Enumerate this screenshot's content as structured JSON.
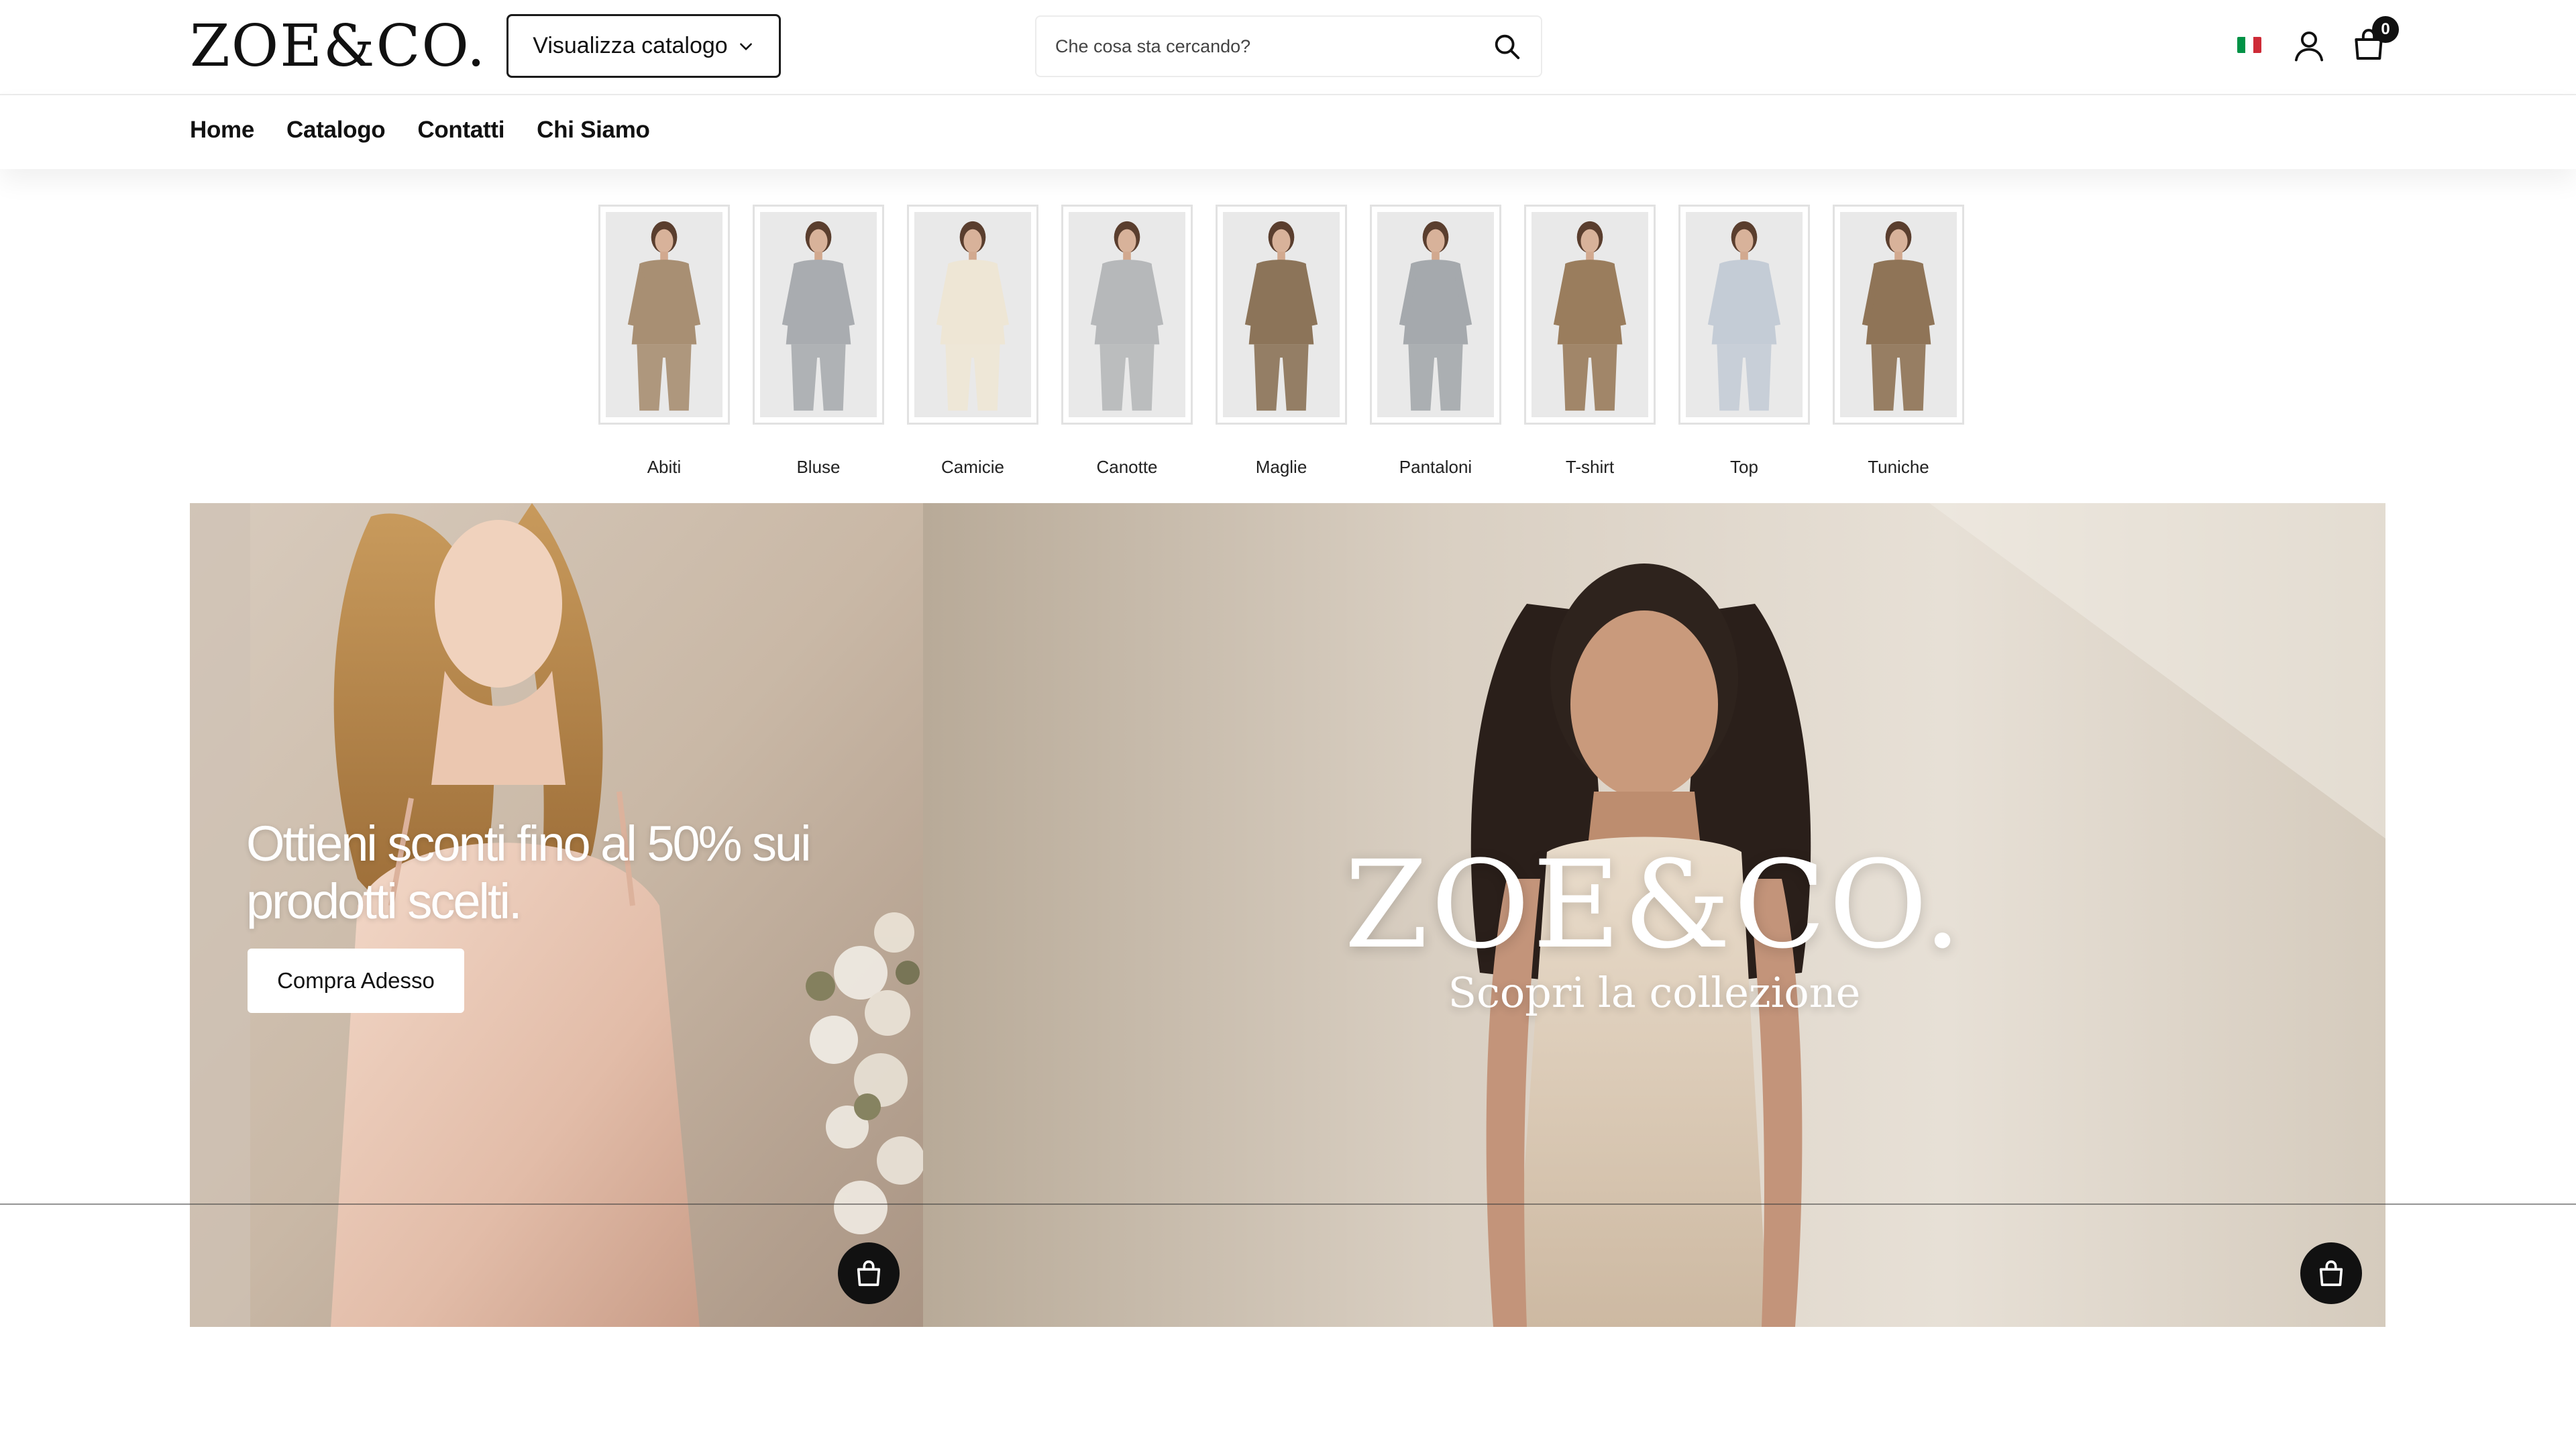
{
  "header": {
    "logo": "ZOE&CO.",
    "catalog_button": "Visualizza catalogo",
    "search_placeholder": "Che cosa sta cercando?",
    "cart_count": "0",
    "flag_colors": [
      "#009246",
      "#ffffff",
      "#ce2b37"
    ]
  },
  "nav": {
    "items": [
      "Home",
      "Catalogo",
      "Contatti",
      "Chi Siamo"
    ]
  },
  "categories": [
    {
      "label": "Abiti",
      "color": "#a88f73",
      "icon": "dress-thumbnail"
    },
    {
      "label": "Bluse",
      "color": "#a9acb0",
      "icon": "blouse-thumbnail"
    },
    {
      "label": "Camicie",
      "color": "#eee6d5",
      "icon": "shirt-thumbnail"
    },
    {
      "label": "Canotte",
      "color": "#b6b8ba",
      "icon": "tank-thumbnail"
    },
    {
      "label": "Maglie",
      "color": "#8c7459",
      "icon": "sweater-thumbnail"
    },
    {
      "label": "Pantaloni",
      "color": "#a5a9ad",
      "icon": "pants-thumbnail"
    },
    {
      "label": "T-shirt",
      "color": "#9a7d5d",
      "icon": "tshirt-thumbnail"
    },
    {
      "label": "Top",
      "color": "#c4ccd6",
      "icon": "top-thumbnail"
    },
    {
      "label": "Tuniche",
      "color": "#8f7457",
      "icon": "tunic-thumbnail"
    }
  ],
  "banners": {
    "left": {
      "headline": "Ottieni sconti fino al 50% sui prodotti scelti.",
      "button": "Compra Adesso"
    },
    "right": {
      "logo": "ZOE&CO.",
      "subtitle": "Scopri la collezione"
    }
  }
}
